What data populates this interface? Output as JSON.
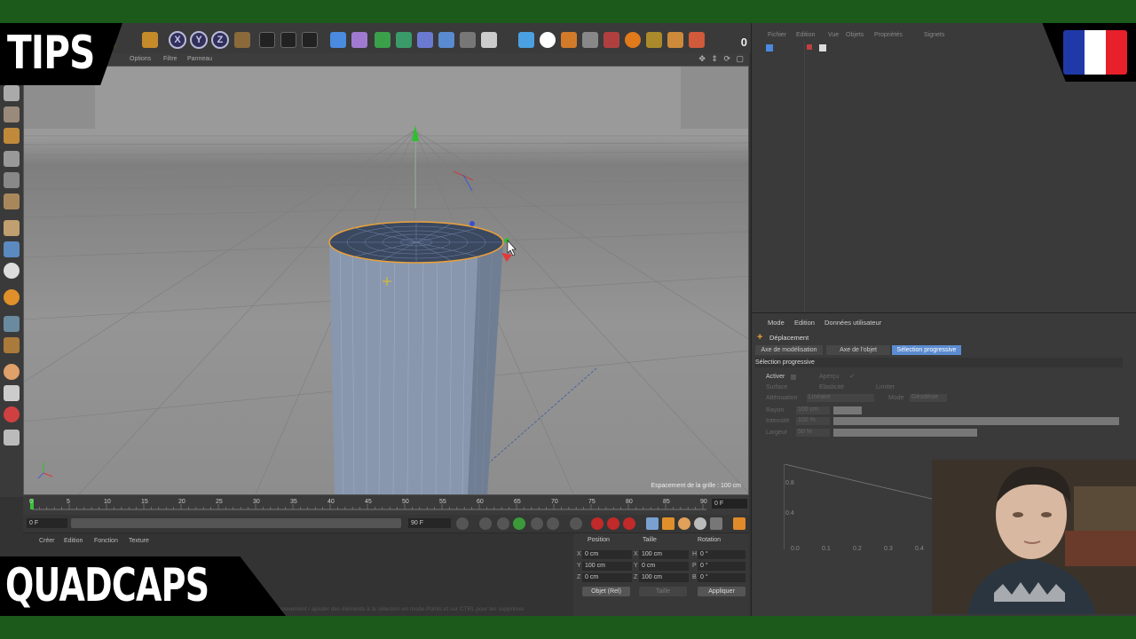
{
  "overlay": {
    "top_title": "TIPS",
    "bottom_title": "QUADCAPS",
    "flag_colors": [
      "#1f3aa8",
      "#ffffff",
      "#e8202a"
    ]
  },
  "toolbar": {
    "axis_x": "X",
    "axis_y": "Y",
    "axis_z": "Z",
    "frame_counter": "0"
  },
  "viewport": {
    "menu": [
      "Options",
      "Filtre",
      "Panneau"
    ],
    "grid_spacing": "Espacement de la grille : 100 cm"
  },
  "timeline": {
    "ticks": [
      "0",
      "5",
      "10",
      "15",
      "20",
      "25",
      "30",
      "35",
      "40",
      "45",
      "50",
      "55",
      "60",
      "65",
      "70",
      "75",
      "80",
      "85",
      "90"
    ],
    "current_frame": "0 F",
    "start_field": "0 F",
    "end_field": "90 F",
    "range_end": "90 F"
  },
  "material_menu": [
    "Créer",
    "Edition",
    "Fonction",
    "Texture"
  ],
  "coordinates": {
    "headers": [
      "Position",
      "Taille",
      "Rotation"
    ],
    "rows": [
      {
        "axis": "X",
        "pos": "0 cm",
        "size_axis": "X",
        "size": "100 cm",
        "rot_axis": "H",
        "rot": "0 °"
      },
      {
        "axis": "Y",
        "pos": "100 cm",
        "size_axis": "Y",
        "size": "0 cm",
        "rot_axis": "P",
        "rot": "0 °"
      },
      {
        "axis": "Z",
        "pos": "0 cm",
        "size_axis": "Z",
        "size": "100 cm",
        "rot_axis": "B",
        "rot": "0 °"
      }
    ],
    "mode_select": "Objet (Rel)",
    "size_select": "Taille",
    "apply_button": "Appliquer"
  },
  "object_manager": {
    "menu": [
      "Fichier",
      "Edition",
      "Vue",
      "Objets",
      "Propriétés",
      "Signets"
    ]
  },
  "attributes": {
    "menu": [
      "Mode",
      "Edition",
      "Données utilisateur"
    ],
    "title": "Déplacement",
    "tabs": [
      "Axe de modélisation",
      "Axe de l'objet",
      "Sélection progressive"
    ],
    "section": "Sélection progressive",
    "activer": "Activer",
    "apercu": "Aperçu",
    "surface": "Surface",
    "elasticite": "Elasticité",
    "limiter": "Limiter",
    "attenuation": "Atténuation",
    "attenuation_val": "Linéaire",
    "mode": "Mode",
    "mode_val": "Géodésie",
    "rayon": "Rayon",
    "rayon_val": "100 cm",
    "intensite": "Intensité",
    "intensite_val": "100 %",
    "largeur": "Largeur",
    "largeur_val": "50 %",
    "graph_y": [
      "0.8",
      "0.4"
    ],
    "graph_x": [
      "0.0",
      "0.1",
      "0.2",
      "0.3",
      "0.4"
    ]
  },
  "status_bar": "Déplacer : Cliquer et glisser pour déplacer les éléments. Appuyez sur SHIFT pour quantifier le mouvement / ajouter des éléments à la sélection en mode Points et sur CTRL pour les supprimer."
}
